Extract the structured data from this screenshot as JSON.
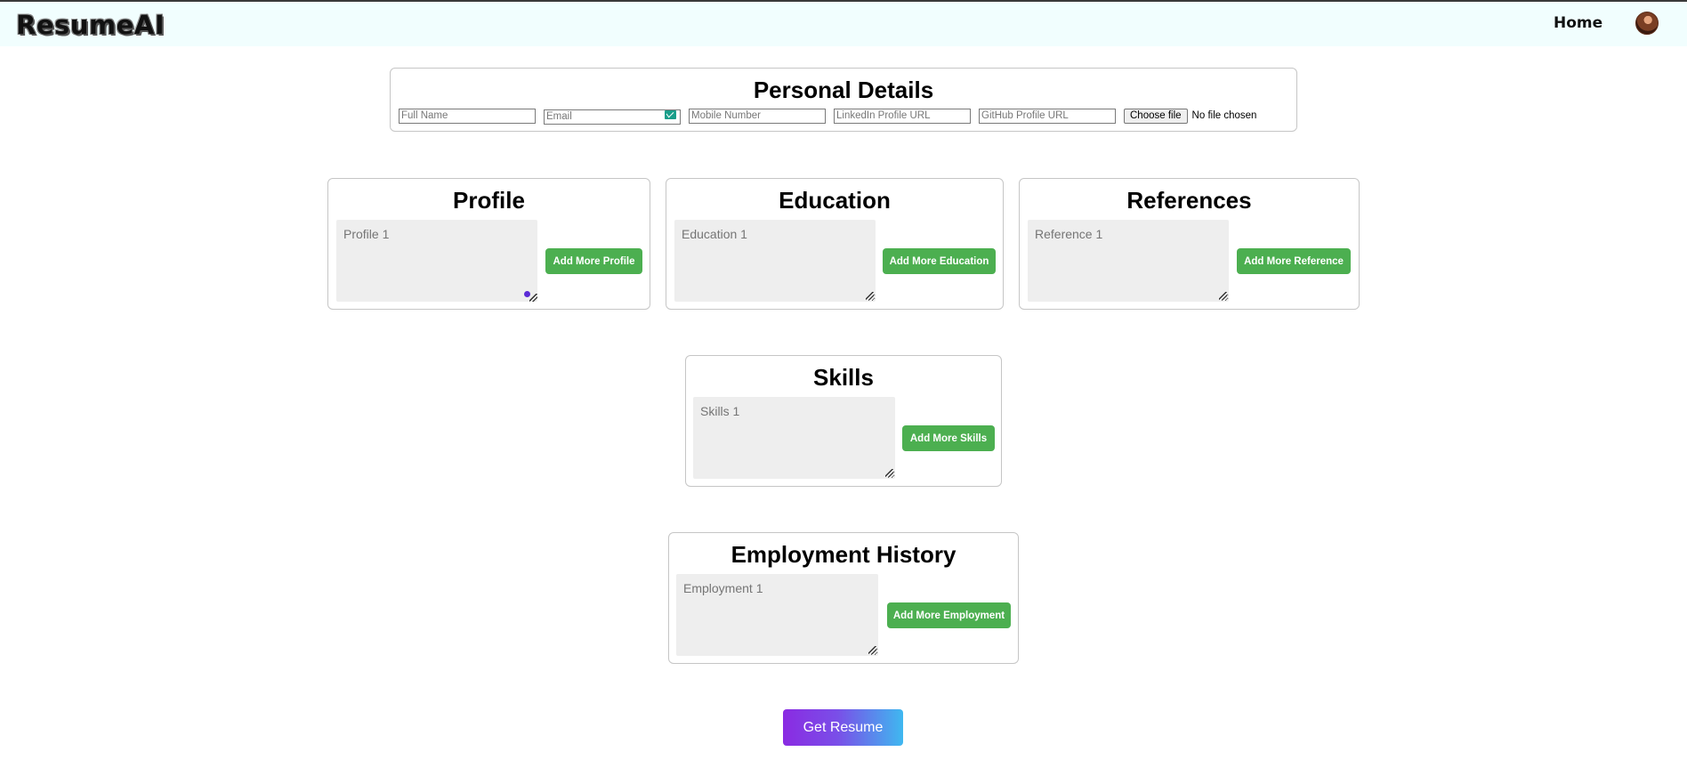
{
  "app": {
    "logo": "ResumeAI",
    "nav_home": "Home"
  },
  "personal_details": {
    "title": "Personal Details",
    "full_name_placeholder": "Full Name",
    "email_placeholder": "Email",
    "mobile_placeholder": "Mobile Number",
    "linkedin_placeholder": "LinkedIn Profile URL",
    "github_placeholder": "GitHub Profile URL",
    "file_button": "Choose file",
    "file_status": "No file chosen"
  },
  "sections": {
    "profile": {
      "title": "Profile",
      "placeholder": "Profile 1",
      "button": "Add More Profile"
    },
    "education": {
      "title": "Education",
      "placeholder": "Education 1",
      "button": "Add More Education"
    },
    "references": {
      "title": "References",
      "placeholder": "Reference 1",
      "button": "Add More Reference"
    },
    "skills": {
      "title": "Skills",
      "placeholder": "Skills 1",
      "button": "Add More Skills"
    },
    "employment": {
      "title": "Employment History",
      "placeholder": "Employment 1",
      "button": "Add More Employment"
    }
  },
  "actions": {
    "get_resume": "Get Resume"
  },
  "colors": {
    "navbar_bg": "#f1fefe",
    "button_green": "#4caf50",
    "textarea_bg": "#eeeeee",
    "gradient_start": "#8a2be2",
    "gradient_end": "#3fb8f0"
  },
  "icons": {
    "email_field_icon": "email-autofill-icon",
    "avatar": "user-avatar",
    "grammar": "grammar-assistant-dot"
  }
}
